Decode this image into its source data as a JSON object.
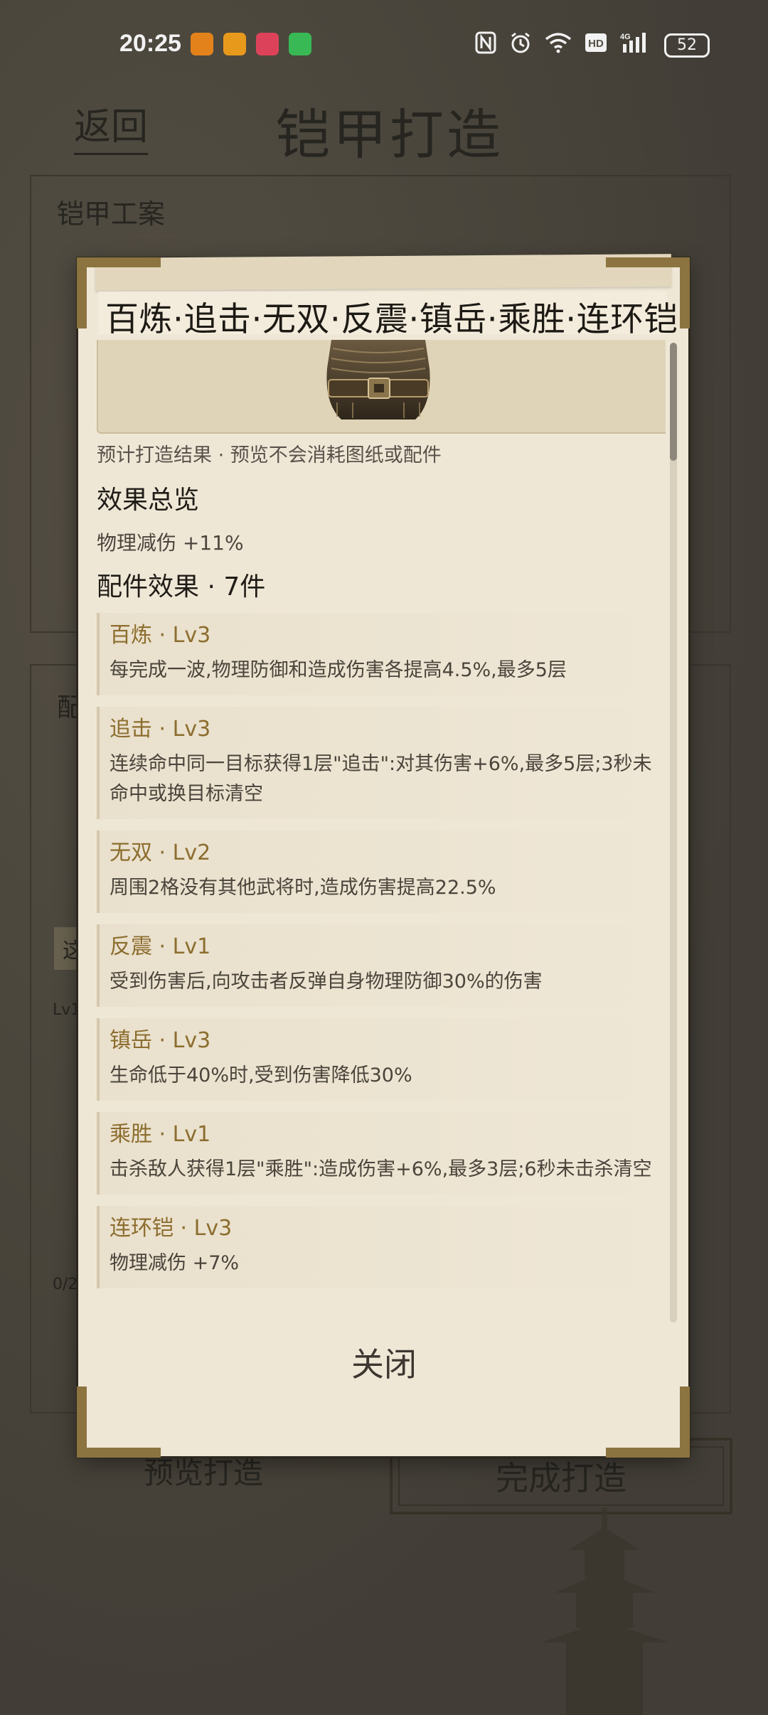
{
  "status_bar": {
    "time": "20:25",
    "battery": "52",
    "icons": [
      "nfc-icon",
      "alarm-icon",
      "wifi-icon",
      "hd-icon",
      "signal-4g-icon"
    ],
    "signal_label": "4G",
    "hd_label": "HD",
    "app_colors": [
      "#f08a1c",
      "#f4a21e",
      "#e8475f",
      "#3cc35a"
    ]
  },
  "background": {
    "back_label": "返回",
    "page_title": "铠甲打造",
    "panel_label": "铠甲工案",
    "partial_labels": [
      "配",
      "这",
      "Lv1",
      "0/2"
    ],
    "preview_button": "预览打造",
    "finish_button": "完成打造"
  },
  "modal": {
    "title": "百炼·追击·无双·反震·镇岳·乘胜·连环铠",
    "note": "预计打造结果 · 预览不会消耗图纸或配件",
    "overview_heading": "效果总览",
    "overview_value": "物理减伤 +11%",
    "parts_heading": "配件效果 · 7件",
    "effects": [
      {
        "name": "百炼 · Lv3",
        "desc": "每完成一波,物理防御和造成伤害各提高4.5%,最多5层"
      },
      {
        "name": "追击 · Lv3",
        "desc": "连续命中同一目标获得1层\"追击\":对其伤害+6%,最多5层;3秒未命中或换目标清空"
      },
      {
        "name": "无双 · Lv2",
        "desc": "周围2格没有其他武将时,造成伤害提高22.5%"
      },
      {
        "name": "反震 · Lv1",
        "desc": "受到伤害后,向攻击者反弹自身物理防御30%的伤害"
      },
      {
        "name": "镇岳 · Lv3",
        "desc": "生命低于40%时,受到伤害降低30%"
      },
      {
        "name": "乘胜 · Lv1",
        "desc": "击杀敌人获得1层\"乘胜\":造成伤害+6%,最多3层;6秒未击杀清空"
      },
      {
        "name": "连环铠 · Lv3",
        "desc": "物理减伤 +7%"
      }
    ],
    "close_label": "关闭",
    "accent_color": "#8c7440"
  }
}
